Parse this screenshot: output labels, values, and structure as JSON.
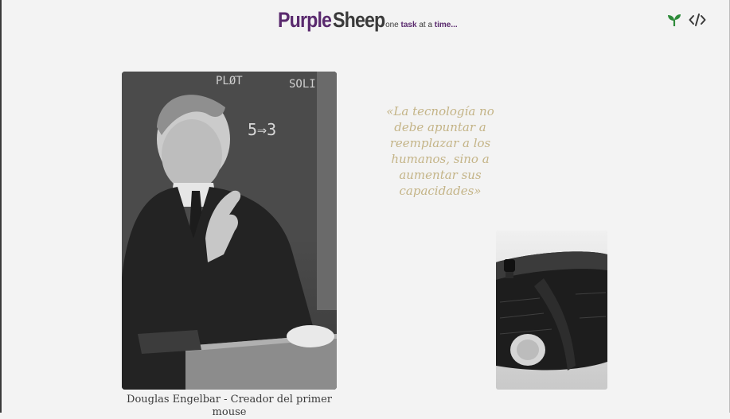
{
  "header": {
    "brand_part1": "Purple",
    "brand_part2": "Sheep",
    "tagline_prefix": "one ",
    "tagline_task": "task",
    "tagline_middle": " at a ",
    "tagline_time": "time..."
  },
  "toolbar": {
    "icons": [
      "sprout-icon",
      "code-icon"
    ],
    "sprout_color": "#2e8b3a"
  },
  "main": {
    "photo_alt": "Douglas Engelbart",
    "caption": "Douglas Engelbar - Creador del primer mouse",
    "quote": "«La tecnología no debe apuntar a reemplazar a los humanos, sino a aumentar sus capacidades»",
    "mouse_alt": "Primer mouse de madera"
  },
  "colors": {
    "brand_purple": "#5a2a6e",
    "brand_dark": "#3a3a3a",
    "quote_gold": "#c4b487",
    "background": "#f3f3f3"
  }
}
